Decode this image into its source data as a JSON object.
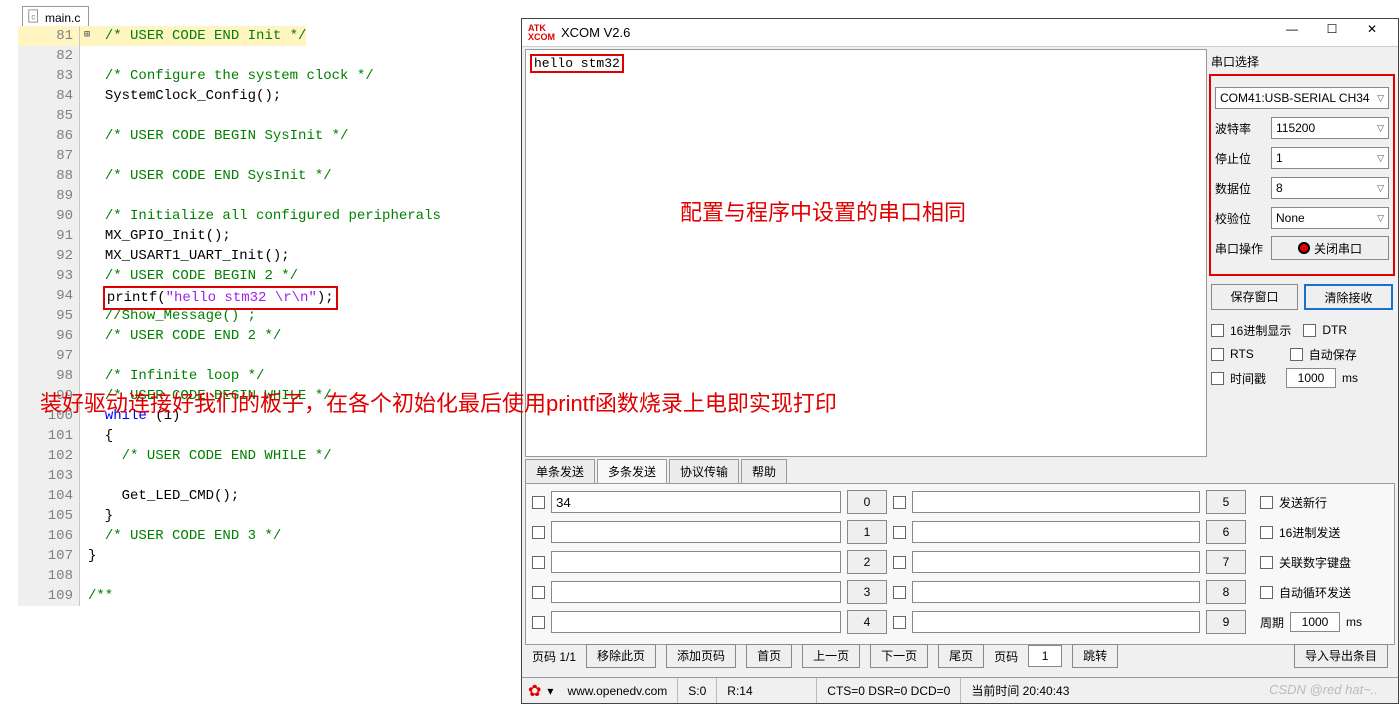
{
  "editor": {
    "tab_filename": "main.c",
    "highlight_line": 94,
    "lines": [
      {
        "n": 81,
        "html": "  <span class='c-comment'>/* USER CODE END Init */</span>"
      },
      {
        "n": 82,
        "html": ""
      },
      {
        "n": 83,
        "html": "  <span class='c-comment'>/* Configure the system clock */</span>"
      },
      {
        "n": 84,
        "html": "  <span class='c-ident'>SystemClock_Config();</span>"
      },
      {
        "n": 85,
        "html": ""
      },
      {
        "n": 86,
        "html": "  <span class='c-comment'>/* USER CODE BEGIN SysInit */</span>"
      },
      {
        "n": 87,
        "html": ""
      },
      {
        "n": 88,
        "html": "  <span class='c-comment'>/* USER CODE END SysInit */</span>"
      },
      {
        "n": 89,
        "html": ""
      },
      {
        "n": 90,
        "html": "  <span class='c-comment'>/* Initialize all configured peripherals</span>"
      },
      {
        "n": 91,
        "html": "  <span class='c-ident'>MX_GPIO_Init();</span>"
      },
      {
        "n": 92,
        "html": "  <span class='c-ident'>MX_USART1_UART_Init();</span>"
      },
      {
        "n": 93,
        "html": "  <span class='c-comment'>/* USER CODE BEGIN 2 */</span>"
      },
      {
        "n": 94,
        "html": "  <span class='hlbox'><span class='c-ident'>printf(</span><span class='c-string'>\"hello stm32 \\r\\n\"</span><span class='c-ident'>);</span></span>"
      },
      {
        "n": 95,
        "html": "  <span class='c-commented'>//Show_Message() ;</span>"
      },
      {
        "n": 96,
        "html": "  <span class='c-comment'>/* USER CODE END 2 */</span>"
      },
      {
        "n": 97,
        "html": ""
      },
      {
        "n": 98,
        "html": "  <span class='c-comment'>/* Infinite loop */</span>"
      },
      {
        "n": 99,
        "html": "  <span class='c-comment'>/* USER CODE BEGIN WHILE */</span>"
      },
      {
        "n": 100,
        "html": "  <span class='c-keyword'>while</span> (1)",
        "fold": "-"
      },
      {
        "n": 101,
        "html": "  {"
      },
      {
        "n": 102,
        "html": "    <span class='c-comment'>/* USER CODE END WHILE */</span>"
      },
      {
        "n": 103,
        "html": ""
      },
      {
        "n": 104,
        "html": "    <span class='c-ident'>Get_LED_CMD();</span>"
      },
      {
        "n": 105,
        "html": "  }"
      },
      {
        "n": 106,
        "html": "  <span class='c-comment'>/* USER CODE END 3 */</span>"
      },
      {
        "n": 107,
        "html": "}"
      },
      {
        "n": 108,
        "html": ""
      },
      {
        "n": 109,
        "html": "<span class='c-comment'>/**</span>",
        "fold": "+"
      }
    ]
  },
  "annotations": {
    "right_text": "配置与程序中设置的串口相同",
    "left_text": "装好驱动连接好我们的板子，在各个初始化最后使用printf函数烧录上电即实现打印"
  },
  "xcom": {
    "logo_top": "ATK",
    "logo_bot": "XCOM",
    "title": "XCOM V2.6",
    "recv_text": "hello stm32",
    "side_header": "串口选择",
    "port_value": "COM41:USB-SERIAL CH34",
    "rows": {
      "baud_label": "波特率",
      "baud_value": "115200",
      "stop_label": "停止位",
      "stop_value": "1",
      "data_label": "数据位",
      "data_value": "8",
      "parity_label": "校验位",
      "parity_value": "None",
      "op_label": "串口操作",
      "op_btn_text": "关闭串口"
    },
    "save_btn": "保存窗口",
    "clear_btn": "清除接收",
    "opts": {
      "hex_disp": "16进制显示",
      "dtr": "DTR",
      "rts": "RTS",
      "autosave": "自动保存",
      "timestamp": "时间戳",
      "ms_value": "1000",
      "ms_unit": "ms"
    },
    "tabs": [
      "单条发送",
      "多条发送",
      "协议传输",
      "帮助"
    ],
    "active_tab": 1,
    "multi_send": {
      "left_col": [
        {
          "chk": false,
          "val": "34",
          "btn": "0"
        },
        {
          "chk": false,
          "val": "",
          "btn": "1"
        },
        {
          "chk": false,
          "val": "",
          "btn": "2"
        },
        {
          "chk": false,
          "val": "",
          "btn": "3"
        },
        {
          "chk": false,
          "val": "",
          "btn": "4"
        }
      ],
      "right_col": [
        {
          "chk": false,
          "val": "",
          "btn": "5"
        },
        {
          "chk": false,
          "val": "",
          "btn": "6"
        },
        {
          "chk": false,
          "val": "",
          "btn": "7"
        },
        {
          "chk": false,
          "val": "",
          "btn": "8"
        },
        {
          "chk": false,
          "val": "",
          "btn": "9"
        }
      ],
      "side_opts": [
        "发送新行",
        "16进制发送",
        "关联数字键盘",
        "自动循环发送"
      ],
      "period_label": "周期",
      "period_value": "1000",
      "period_unit": "ms"
    },
    "page_row": {
      "page_label": "页码 1/1",
      "remove": "移除此页",
      "add": "添加页码",
      "first": "首页",
      "prev": "上一页",
      "next": "下一页",
      "last": "尾页",
      "page_no_label": "页码",
      "page_no_value": "1",
      "jump": "跳转",
      "import": "导入导出条目"
    },
    "status": {
      "url": "www.openedv.com",
      "s": "S:0",
      "r": "R:14",
      "cts": "CTS=0 DSR=0 DCD=0",
      "time_label": "当前时间 20:40:43"
    },
    "watermark": "CSDN @red hat~.."
  }
}
